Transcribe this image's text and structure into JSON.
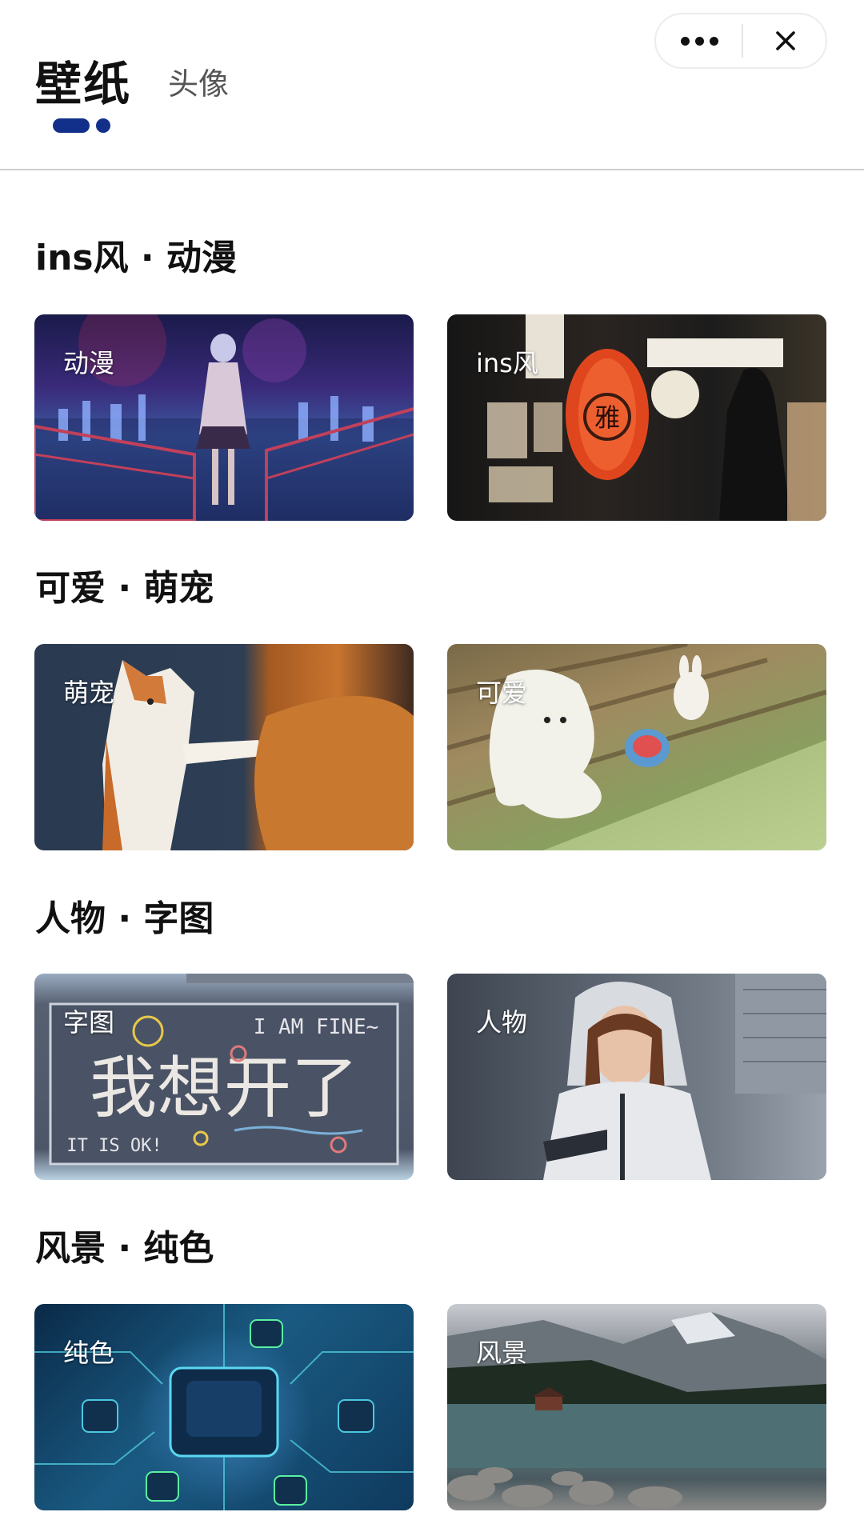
{
  "header": {
    "active_tab": "壁纸",
    "other_tab": "头像"
  },
  "capsule": {
    "more_icon": "more-dots-icon",
    "close_icon": "close-icon"
  },
  "sections": [
    {
      "title": "ins风 · 动漫",
      "cards": [
        {
          "label": "动漫",
          "icon": "anime-girl-image"
        },
        {
          "label": "ins风",
          "icon": "lantern-shop-image"
        }
      ]
    },
    {
      "title": "可爱 · 萌宠",
      "cards": [
        {
          "label": "萌宠",
          "icon": "cat-image"
        },
        {
          "label": "可爱",
          "icon": "fluffy-toy-image"
        }
      ]
    },
    {
      "title": "人物 · 字图",
      "cards": [
        {
          "label": "字图",
          "icon": "text-art-image"
        },
        {
          "label": "人物",
          "icon": "person-image"
        }
      ]
    },
    {
      "title": "风景 · 纯色",
      "cards": [
        {
          "label": "纯色",
          "icon": "circuit-image"
        },
        {
          "label": "风景",
          "icon": "lake-image"
        }
      ]
    }
  ],
  "text_art": {
    "top": "I AM FINE~",
    "main": "我想开了",
    "bottom": "IT IS OK!"
  },
  "lantern_text": "雅",
  "colors": {
    "accent": "#12308a",
    "divider": "#cfcfcf"
  }
}
